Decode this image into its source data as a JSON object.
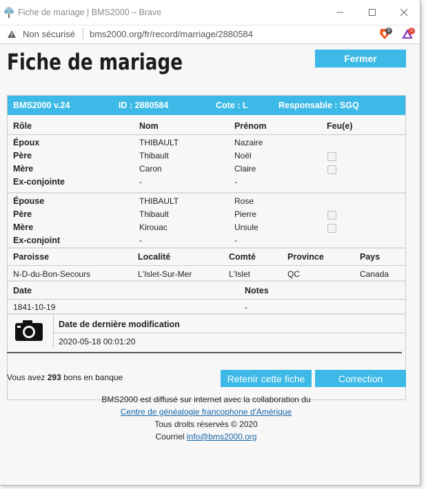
{
  "window": {
    "title": "Fiche de mariage | BMS2000 – Brave"
  },
  "addressbar": {
    "security_label": "Non sécurisé",
    "url": "bms2000.org/fr/record/marriage/2880584",
    "shield_count": "3",
    "rewards_count": "1"
  },
  "page": {
    "title": "Fiche de mariage",
    "close_label": "Fermer"
  },
  "record": {
    "header": {
      "version": "BMS2000 v.24",
      "id": "ID : 2880584",
      "cote": "Cote : L",
      "responsable": "Responsable : SGQ"
    },
    "columns": [
      "Rôle",
      "Nom",
      "Prénom",
      "Feu(e)"
    ],
    "groups": [
      {
        "rows": [
          {
            "role": "Époux",
            "nom": "THIBAULT",
            "prenom": "Nazaire",
            "checkbox": false
          },
          {
            "role": "Père",
            "nom": "Thibault",
            "prenom": "Noël",
            "checkbox": true
          },
          {
            "role": "Mère",
            "nom": "Caron",
            "prenom": "Claire",
            "checkbox": true
          },
          {
            "role": "Ex-conjointe",
            "nom": "-",
            "prenom": "-",
            "checkbox": false
          }
        ]
      },
      {
        "rows": [
          {
            "role": "Épouse",
            "nom": "THIBAULT",
            "prenom": "Rose",
            "checkbox": false
          },
          {
            "role": "Père",
            "nom": "Thibault",
            "prenom": "Pierre",
            "checkbox": true
          },
          {
            "role": "Mère",
            "nom": "Kirouac",
            "prenom": "Ursule",
            "checkbox": true
          },
          {
            "role": "Ex-conjoint",
            "nom": "-",
            "prenom": "-",
            "checkbox": false
          }
        ]
      }
    ],
    "location": {
      "headers": [
        "Paroisse",
        "Localité",
        "Comté",
        "Province",
        "Pays"
      ],
      "values": [
        "N-D-du-Bon-Secours",
        "L'Islet-Sur-Mer",
        "L'Islet",
        "QC",
        "Canada"
      ]
    },
    "date_section": {
      "headers": [
        "Date",
        "Notes"
      ],
      "values": [
        "1841-10-19",
        "-"
      ]
    },
    "modification": {
      "label": "Date de dernière modification",
      "value": "2020-05-18 00:01:20"
    }
  },
  "bank": {
    "prefix": "Vous avez",
    "count": "293",
    "suffix": "bons en banque"
  },
  "actions": {
    "retain_label": "Retenir cette fiche",
    "correction_label": "Correction"
  },
  "footer": {
    "line1": "BMS2000 est diffusé sur internet avec la collaboration du",
    "link": "Centre de généalogie francophone d'Amérique",
    "rights": "Tous droits réservés © 2020",
    "mail_prefix": "Courriel",
    "mail": "info@bms2000.org"
  }
}
